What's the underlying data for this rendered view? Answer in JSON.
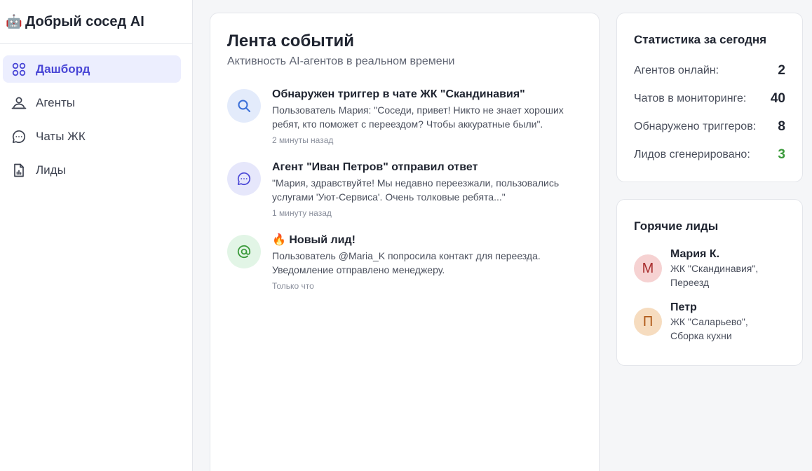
{
  "app": {
    "logo_emoji": "🤖",
    "title": "Добрый сосед AI"
  },
  "sidebar": {
    "items": [
      {
        "label": "Дашборд",
        "icon": "dashboard-grid-icon",
        "active": true
      },
      {
        "label": "Агенты",
        "icon": "agents-icon",
        "active": false
      },
      {
        "label": "Чаты ЖК",
        "icon": "chat-bubble-icon",
        "active": false
      },
      {
        "label": "Лиды",
        "icon": "document-chart-icon",
        "active": false
      }
    ]
  },
  "feed": {
    "title": "Лента событий",
    "subtitle": "Активность AI-агентов в реальном времени",
    "events": [
      {
        "icon": "search-icon",
        "title": "Обнаружен триггер в чате ЖК \"Скандинавия\"",
        "text": "Пользователь Мария: \"Соседи, привет! Никто не знает хороших ребят, кто поможет с переездом? Чтобы аккуратные были\".",
        "time": "2 минуты назад"
      },
      {
        "icon": "chat-bubble-icon",
        "title": "Агент \"Иван Петров\" отправил ответ",
        "text": "\"Мария, здравствуйте! Мы недавно переезжали, пользовались услугами 'Уют-Сервиса'. Очень толковые ребята...\"",
        "time": "1 минуту назад"
      },
      {
        "icon": "at-sign-icon",
        "title": "🔥 Новый лид!",
        "text": "Пользователь @Maria_K попросила контакт для переезда. Уведомление отправлено менеджеру.",
        "time": "Только что"
      }
    ]
  },
  "stats": {
    "title": "Статистика за сегодня",
    "rows": [
      {
        "label": "Агентов онлайн:",
        "value": "2"
      },
      {
        "label": "Чатов в мониторинге:",
        "value": "40"
      },
      {
        "label": "Обнаружено триггеров:",
        "value": "8"
      },
      {
        "label": "Лидов сгенерировано:",
        "value": "3"
      }
    ]
  },
  "leads": {
    "title": "Горячие лиды",
    "items": [
      {
        "initial": "М",
        "name": "Мария К.",
        "detail": "ЖК \"Скандинавия\", Переезд"
      },
      {
        "initial": "П",
        "name": "Петр",
        "detail": "ЖК \"Саларьево\", Сборка кухни"
      }
    ]
  },
  "colors": {
    "accent": "#4a47d6",
    "active_bg": "#eceefe",
    "success": "#3a9a3a",
    "search_icon_bg": "#e3ebfb",
    "chat_icon_bg": "#e6e7fb",
    "at_icon_bg": "#e2f5e6",
    "avatar_m_bg": "#f6d2d2",
    "avatar_p_bg": "#f6dcbf"
  }
}
